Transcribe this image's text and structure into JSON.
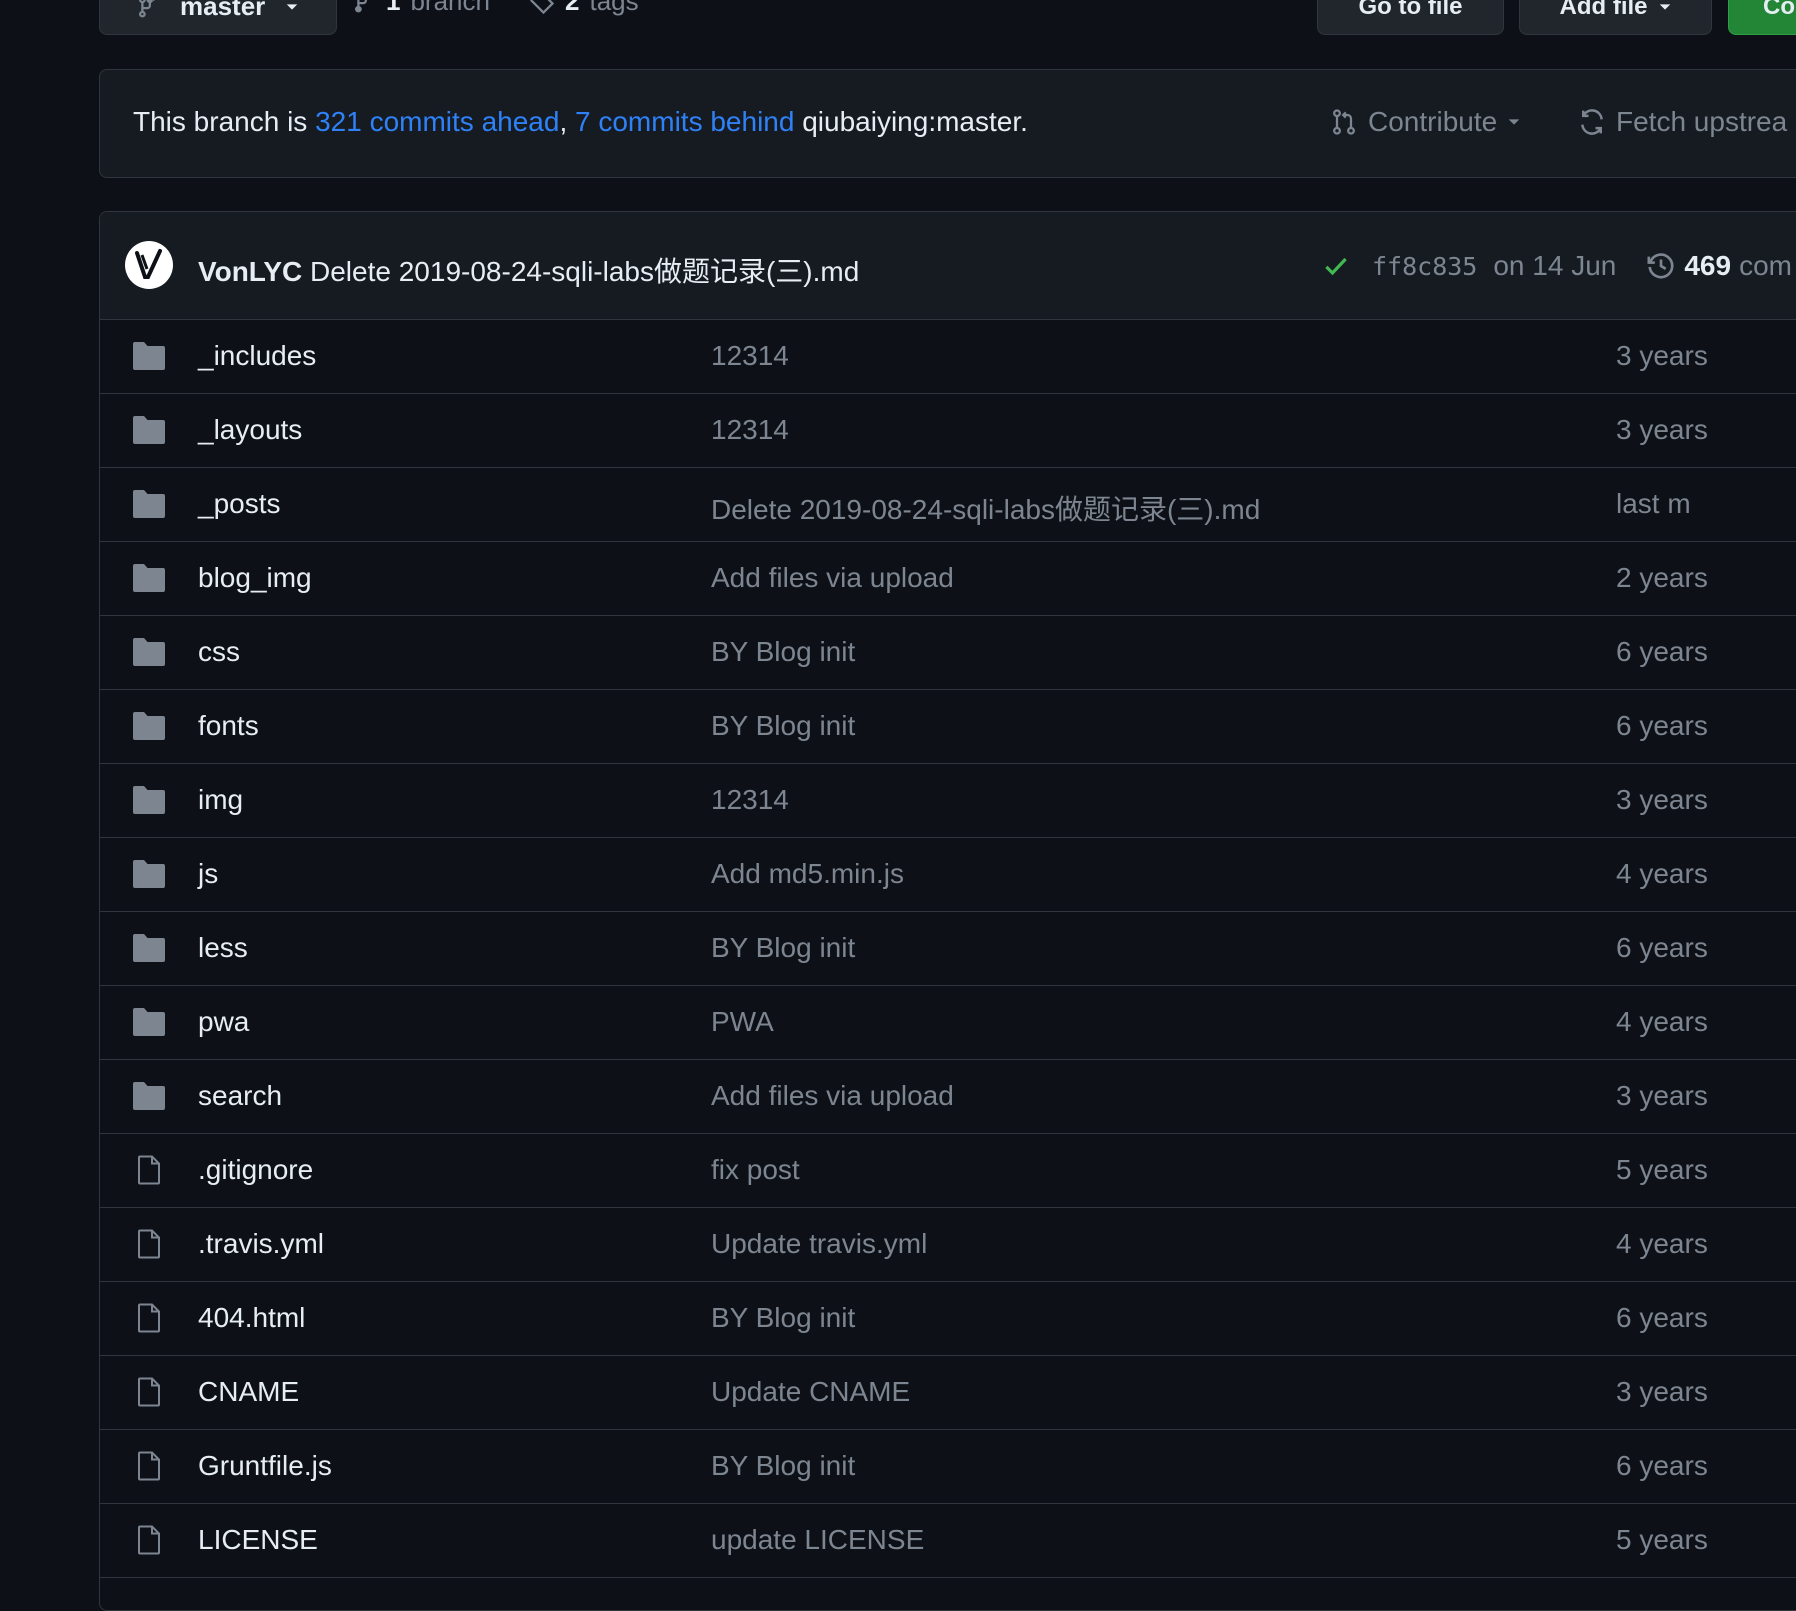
{
  "toolbar": {
    "branch_label": "master",
    "branches_count": "1",
    "branches_label": "branch",
    "tags_count": "2",
    "tags_label": "tags",
    "go_to_file_label": "Go to file",
    "add_file_label": "Add file",
    "code_label": "Co"
  },
  "status": {
    "prefix": "This branch is ",
    "ahead": "321 commits ahead",
    "separator": ", ",
    "behind": "7 commits behind",
    "upstream": " qiubaiying:master.",
    "contribute_label": "Contribute",
    "fetch_label": "Fetch upstrea"
  },
  "latest_commit": {
    "author": "VonLYC",
    "message": "Delete 2019-08-24-sqli-labs做题记录(三).md",
    "sha": "ff8c835",
    "date": "on 14 Jun",
    "commits_count": "469",
    "commits_label": "com"
  },
  "files": [
    {
      "type": "folder",
      "name": "_includes",
      "message": "12314",
      "age": "3 years"
    },
    {
      "type": "folder",
      "name": "_layouts",
      "message": "12314",
      "age": "3 years"
    },
    {
      "type": "folder",
      "name": "_posts",
      "message": "Delete 2019-08-24-sqli-labs做题记录(三).md",
      "age": "last m"
    },
    {
      "type": "folder",
      "name": "blog_img",
      "message": "Add files via upload",
      "age": "2 years"
    },
    {
      "type": "folder",
      "name": "css",
      "message": "BY Blog init",
      "age": "6 years"
    },
    {
      "type": "folder",
      "name": "fonts",
      "message": "BY Blog init",
      "age": "6 years"
    },
    {
      "type": "folder",
      "name": "img",
      "message": "12314",
      "age": "3 years"
    },
    {
      "type": "folder",
      "name": "js",
      "message": "Add md5.min.js",
      "age": "4 years"
    },
    {
      "type": "folder",
      "name": "less",
      "message": "BY Blog init",
      "age": "6 years"
    },
    {
      "type": "folder",
      "name": "pwa",
      "message": "PWA",
      "age": "4 years"
    },
    {
      "type": "folder",
      "name": "search",
      "message": "Add files via upload",
      "age": "3 years"
    },
    {
      "type": "file",
      "name": ".gitignore",
      "message": "fix post",
      "age": "5 years"
    },
    {
      "type": "file",
      "name": ".travis.yml",
      "message": "Update travis.yml",
      "age": "4 years"
    },
    {
      "type": "file",
      "name": "404.html",
      "message": "BY Blog init",
      "age": "6 years"
    },
    {
      "type": "file",
      "name": "CNAME",
      "message": "Update CNAME",
      "age": "3 years"
    },
    {
      "type": "file",
      "name": "Gruntfile.js",
      "message": "BY Blog init",
      "age": "6 years"
    },
    {
      "type": "file",
      "name": "LICENSE",
      "message": "update LICENSE",
      "age": "5 years"
    }
  ],
  "colors": {
    "background": "#0d1117",
    "link": "#2f81f7",
    "success_check": "#3fb950",
    "muted_text": "#7d8590",
    "primary_button": "#238636"
  }
}
